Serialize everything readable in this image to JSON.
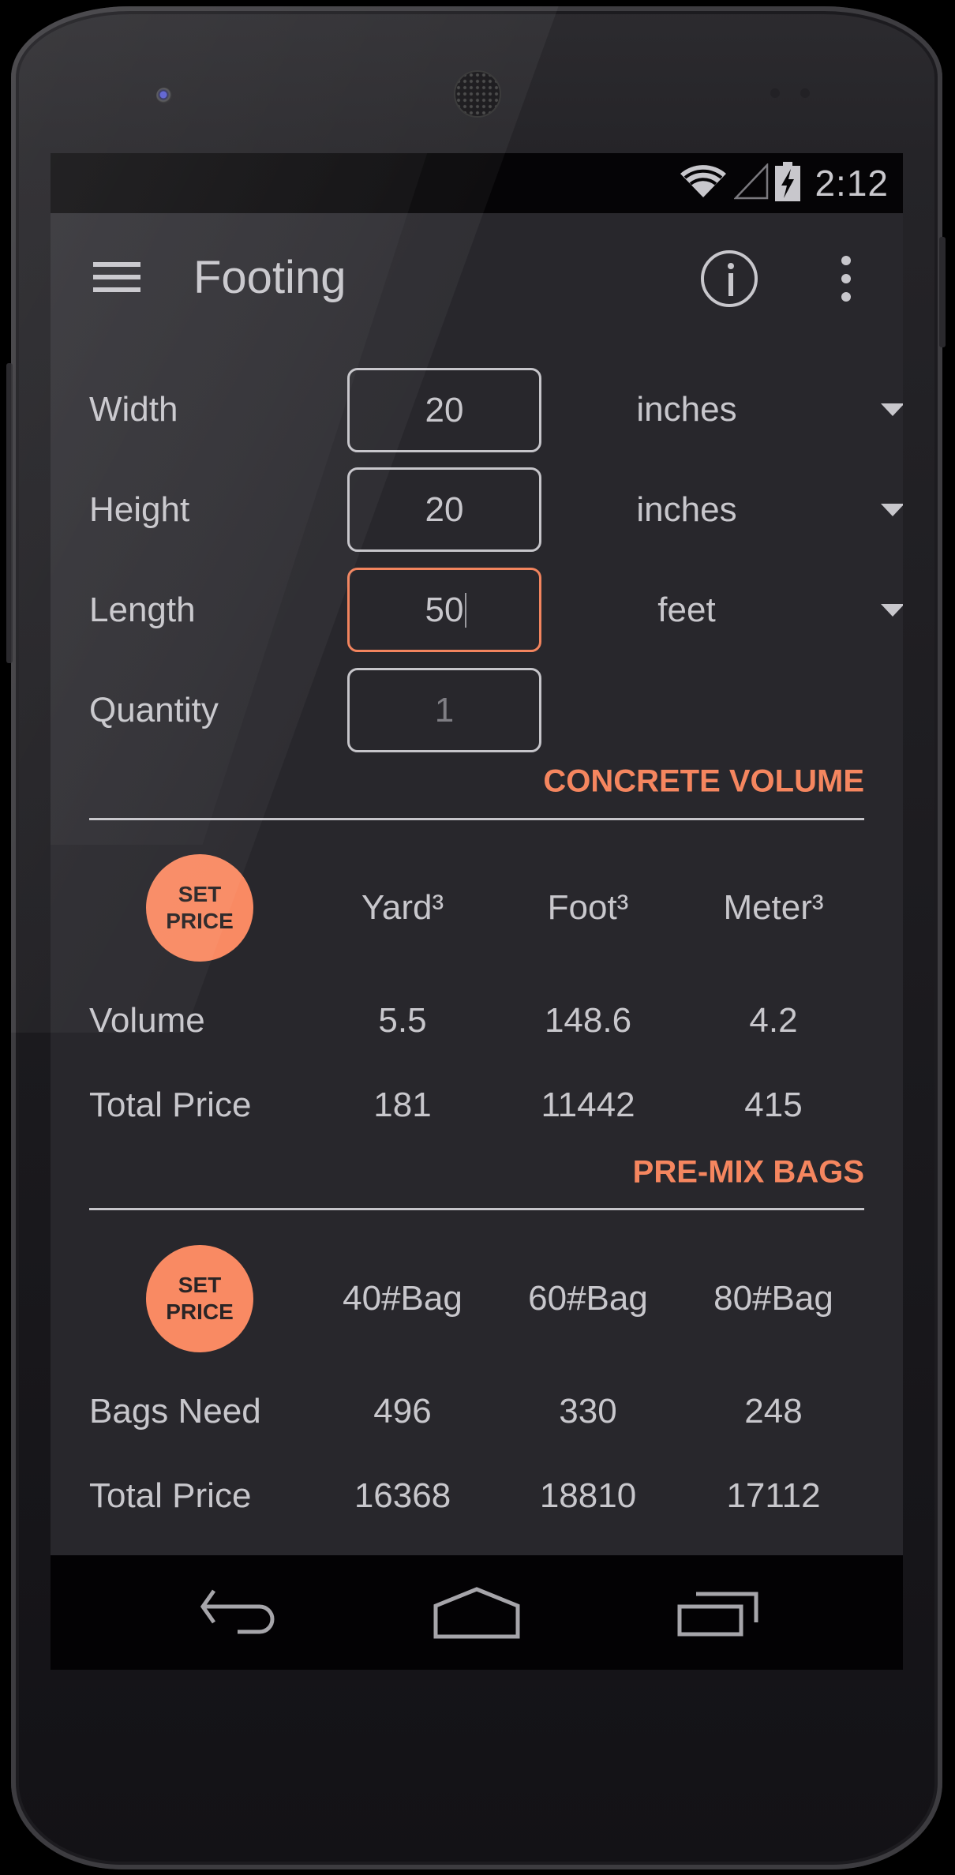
{
  "status_bar": {
    "time": "2:12",
    "icons": [
      "wifi-icon",
      "cell-signal-icon",
      "battery-charging-icon"
    ]
  },
  "app_bar": {
    "title": "Footing",
    "menu_icon": "hamburger-icon",
    "info_icon": "info-icon",
    "overflow_icon": "more-vert-icon"
  },
  "inputs": [
    {
      "label": "Width",
      "value": "20",
      "placeholder": "",
      "unit": "inches",
      "has_unit": true,
      "focused": false
    },
    {
      "label": "Height",
      "value": "20",
      "placeholder": "",
      "unit": "inches",
      "has_unit": true,
      "focused": false
    },
    {
      "label": "Length",
      "value": "50",
      "placeholder": "",
      "unit": "feet",
      "has_unit": true,
      "focused": true
    },
    {
      "label": "Quantity",
      "value": "",
      "placeholder": "1",
      "has_unit": false,
      "focused": false
    }
  ],
  "concrete_volume": {
    "title": "CONCRETE VOLUME",
    "set_price_label": [
      "SET",
      "PRICE"
    ],
    "columns": [
      "Yard³",
      "Foot³",
      "Meter³"
    ],
    "rows": [
      {
        "label": "Volume",
        "values": [
          "5.5",
          "148.6",
          "4.2"
        ]
      },
      {
        "label": "Total Price",
        "values": [
          "181",
          "11442",
          "415"
        ]
      }
    ]
  },
  "premix_bags": {
    "title": "PRE-MIX BAGS",
    "set_price_label": [
      "SET",
      "PRICE"
    ],
    "columns": [
      "40#Bag",
      "60#Bag",
      "80#Bag"
    ],
    "rows": [
      {
        "label": "Bags Need",
        "values": [
          "496",
          "330",
          "248"
        ]
      },
      {
        "label": "Total Price",
        "values": [
          "16368",
          "18810",
          "17112"
        ]
      }
    ]
  },
  "nav_bar": {
    "buttons": [
      "back-icon",
      "home-icon",
      "recents-icon"
    ]
  },
  "colors": {
    "accent": "#F5865F",
    "set_price_bg": "#F98A63",
    "background": "#28272C",
    "text": "#C8C7CC"
  }
}
